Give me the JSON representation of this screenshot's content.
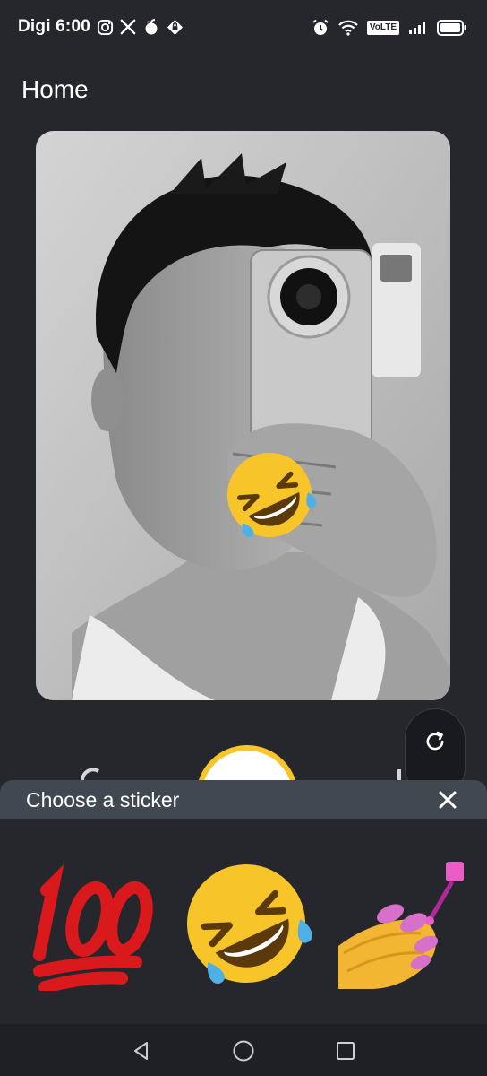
{
  "status_bar": {
    "carrier_time": "Digi 6:00",
    "left_icons": [
      "instagram-icon",
      "x-icon",
      "apple-icon",
      "vpn-icon"
    ],
    "volte_label": "VoLTE",
    "right_icons": [
      "alarm-icon",
      "wifi-icon",
      "signal-icon",
      "battery-icon"
    ]
  },
  "app_bar": {
    "title": "Home"
  },
  "photo": {
    "overlay_sticker": "rolling-on-floor-laughing-emoji"
  },
  "controls": {
    "flip_icon": "refresh-icon"
  },
  "sticker_sheet": {
    "title": "Choose a sticker",
    "close_icon": "close-icon",
    "stickers": [
      {
        "name": "hundred-points-emoji"
      },
      {
        "name": "rolling-on-floor-laughing-emoji"
      },
      {
        "name": "nail-polish-emoji"
      }
    ]
  },
  "nav_bar": {
    "buttons": [
      "back-icon",
      "home-icon",
      "recents-icon"
    ]
  },
  "colors": {
    "background": "#25272d",
    "sheet_header": "#424852",
    "nav_bar": "#1f2025",
    "accent_yellow": "#f7c52a"
  }
}
